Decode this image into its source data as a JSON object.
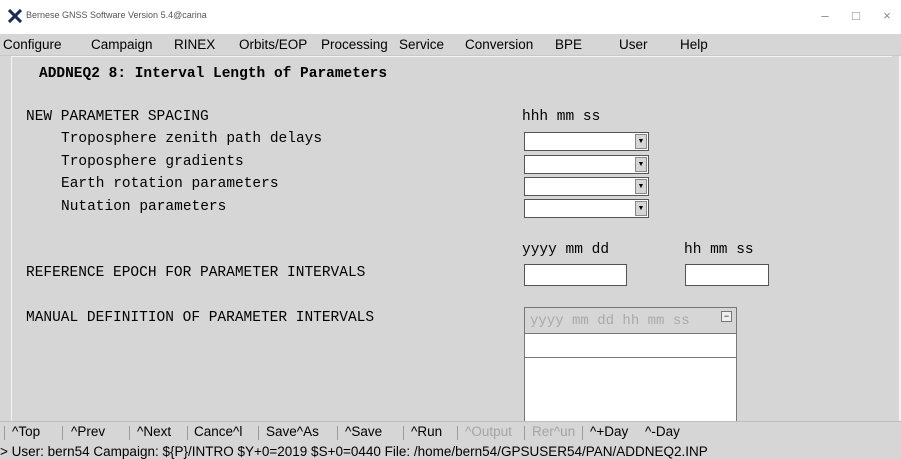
{
  "window": {
    "title": "Bernese GNSS Software Version 5.4@carina",
    "minimize_glyph": "–",
    "maximize_glyph": "□",
    "close_glyph": "×"
  },
  "menu": {
    "items": [
      "Configure",
      "Campaign",
      "RINEX",
      "Orbits/EOP",
      "Processing",
      "Service",
      "Conversion",
      "BPE",
      "User",
      "Help"
    ]
  },
  "panel": {
    "title": "ADDNEQ2 8: Interval Length of Parameters",
    "new_spacing": {
      "header": "NEW PARAMETER SPACING",
      "format": "hhh mm ss",
      "rows": [
        {
          "label": "Troposphere zenith path delays",
          "value": ""
        },
        {
          "label": "Troposphere gradients",
          "value": ""
        },
        {
          "label": "Earth rotation parameters",
          "value": ""
        },
        {
          "label": "Nutation parameters",
          "value": ""
        }
      ]
    },
    "reference_epoch": {
      "label": "REFERENCE EPOCH FOR PARAMETER INTERVALS",
      "date_format": "yyyy mm dd",
      "time_format": "hh mm ss",
      "date_value": "",
      "time_value": ""
    },
    "manual": {
      "label": "MANUAL DEFINITION OF PARAMETER INTERVALS",
      "column_header": "yyyy mm dd hh mm ss",
      "row_value": ""
    }
  },
  "buttons": {
    "items": [
      {
        "label": "^Top",
        "enabled": true
      },
      {
        "label": "^Prev",
        "enabled": true
      },
      {
        "label": "^Next",
        "enabled": true
      },
      {
        "label": "Cance^l",
        "enabled": true
      },
      {
        "label": "Save^As",
        "enabled": true
      },
      {
        "label": "^Save",
        "enabled": true
      },
      {
        "label": "^Run",
        "enabled": true
      },
      {
        "label": "^Output",
        "enabled": false
      },
      {
        "label": "Rer^un",
        "enabled": false
      },
      {
        "label": "^+Day",
        "enabled": true
      },
      {
        "label": "^-Day",
        "enabled": true
      }
    ]
  },
  "status": {
    "text": "> User: bern54  Campaign: ${P}/INTRO  $Y+0=2019  $S+0=0440  File: /home/bern54/GPSUSER54/PAN/ADDNEQ2.INP"
  },
  "colors": {
    "background": "#d6d6d6",
    "disabled_text": "#a4a4a4",
    "field_background": "#ffffff"
  }
}
